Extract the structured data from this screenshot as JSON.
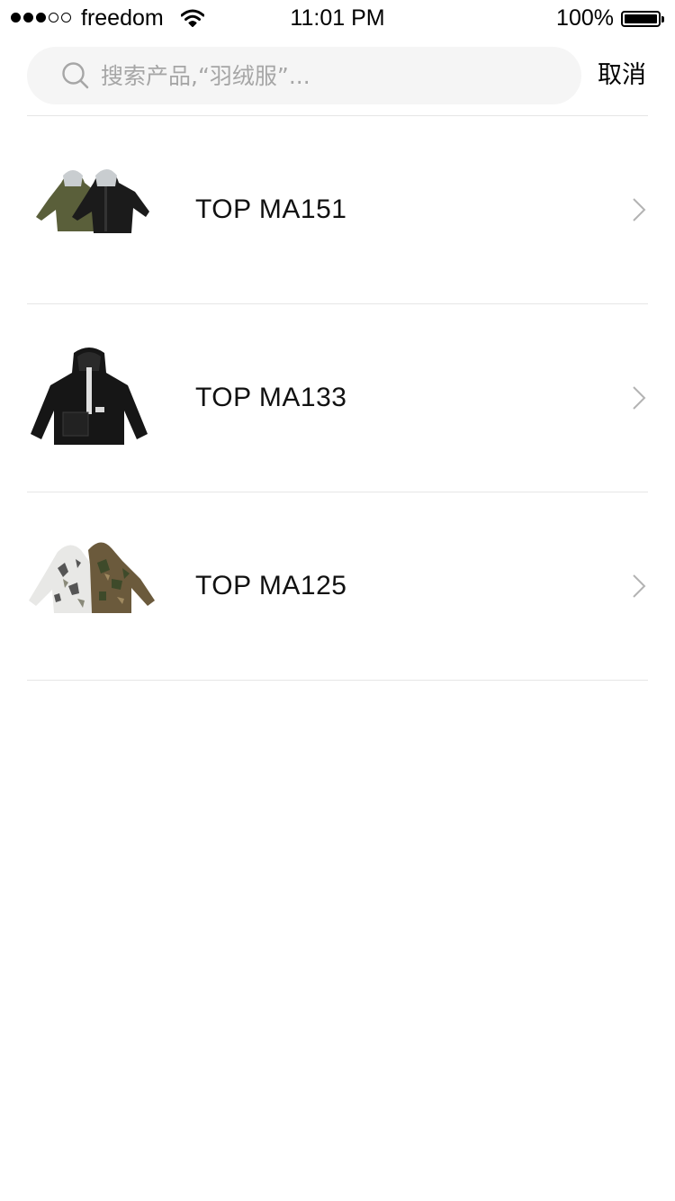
{
  "status_bar": {
    "carrier": "freedom",
    "time": "11:01 PM",
    "battery": "100%",
    "signal_bars_filled": 3,
    "signal_bars_total": 5
  },
  "search": {
    "placeholder": "搜索产品,“羽绒服”...",
    "value": "",
    "cancel_label": "取消"
  },
  "products": [
    {
      "name": "TOP MA151",
      "thumb_icon": "puffer-jackets-thumbnail"
    },
    {
      "name": "TOP MA133",
      "thumb_icon": "black-jacket-thumbnail"
    },
    {
      "name": "TOP MA125",
      "thumb_icon": "camo-jackets-thumbnail"
    }
  ],
  "colors": {
    "search_bg": "#f5f5f5",
    "divider": "#e6e6e6",
    "placeholder": "#a6a6a6",
    "chevron": "#b3b3b3"
  }
}
